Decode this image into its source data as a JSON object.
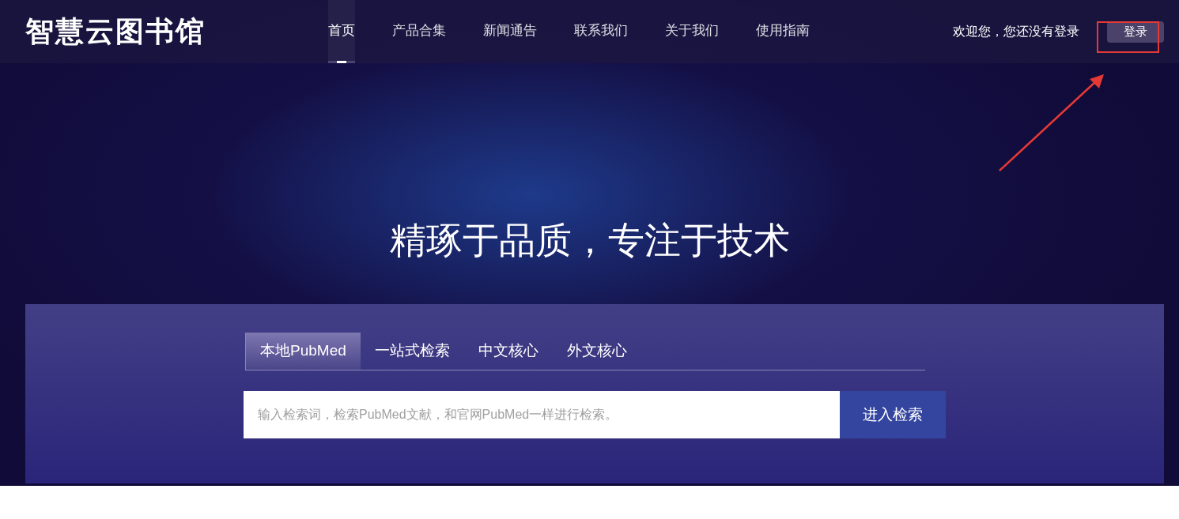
{
  "logo": "智慧云图书馆",
  "nav": [
    {
      "label": "首页",
      "selected": true
    },
    {
      "label": "产品合集",
      "selected": false
    },
    {
      "label": "新闻通告",
      "selected": false
    },
    {
      "label": "联系我们",
      "selected": false
    },
    {
      "label": "关于我们",
      "selected": false
    },
    {
      "label": "使用指南",
      "selected": false
    }
  ],
  "welcome": "欢迎您，您还没有登录",
  "login_button": "登录",
  "headline": "精琢于品质，专注于技术",
  "search_tabs": [
    {
      "label": "本地PubMed",
      "selected": true
    },
    {
      "label": "一站式检索",
      "selected": false
    },
    {
      "label": "中文核心",
      "selected": false
    },
    {
      "label": "外文核心",
      "selected": false
    }
  ],
  "search": {
    "placeholder": "输入检索词，检索PubMed文献，和官网PubMed一样进行检索。"
  },
  "search_button": "进入检索"
}
